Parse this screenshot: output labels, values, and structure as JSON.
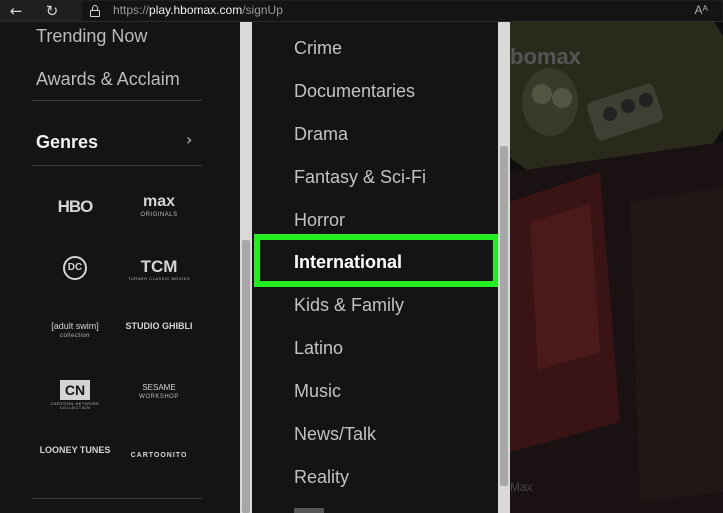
{
  "browser": {
    "url_protocol": "https://",
    "url_host": "play.hbomax.com",
    "url_path": "/signUp",
    "read_aloud": "Aᴬ"
  },
  "leftnav": {
    "links": [
      "Trending Now",
      "Awards & Acclaim"
    ],
    "genres_label": "Genres",
    "brands": [
      {
        "name": "HBO",
        "sub": ""
      },
      {
        "name": "max",
        "sub": "ORIGINALS"
      },
      {
        "name": "DC",
        "sub": ""
      },
      {
        "name": "TCM",
        "sub": "TURNER CLASSIC MOVIES"
      },
      {
        "name": "[adult swim]",
        "sub": "collection"
      },
      {
        "name": "STUDIO GHIBLI",
        "sub": ""
      },
      {
        "name": "CN",
        "sub": "CARTOON NETWORK COLLECTION"
      },
      {
        "name": "SESAME",
        "sub": "WORKSHOP"
      },
      {
        "name": "LOONEY TUNES",
        "sub": ""
      },
      {
        "name": "CARTOONITO",
        "sub": ""
      }
    ]
  },
  "genre_list": {
    "items": [
      "Crime",
      "Documentaries",
      "Drama",
      "Fantasy & Sci-Fi",
      "Horror",
      "International",
      "Kids & Family",
      "Latino",
      "Music",
      "News/Talk",
      "Reality"
    ],
    "selected": "International"
  },
  "backdrop": {
    "logo": "bomax",
    "footer": "Max"
  },
  "colors": {
    "highlight": "#22ee22",
    "background": "#141414"
  },
  "icons": [
    "back-arrow-icon",
    "refresh-icon",
    "lock-icon",
    "chevron-right-icon",
    "read-aloud-icon"
  ]
}
